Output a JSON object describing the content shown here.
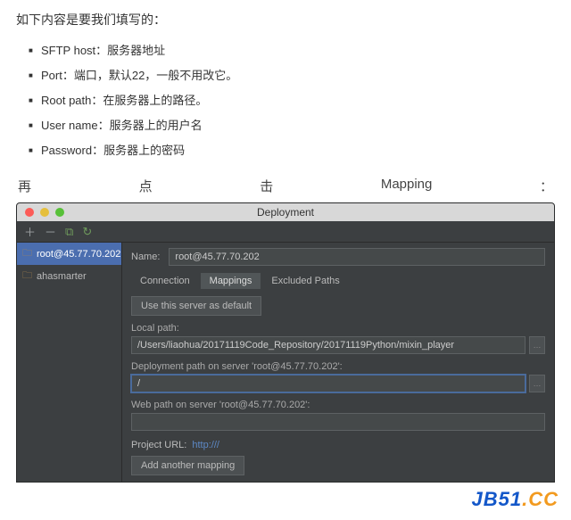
{
  "doc": {
    "lead": "如下内容是要我们填写的：",
    "bullets": [
      "SFTP host：服务器地址",
      "Port：端口，默认22，一般不用改它。",
      "Root path：在服务器上的路径。",
      "User name：服务器上的用户名",
      "Password：服务器上的密码"
    ],
    "spread": [
      "再",
      "点",
      "击",
      "Mapping",
      "："
    ]
  },
  "win": {
    "title": "Deployment",
    "sidebar": {
      "items": [
        {
          "label": "root@45.77.70.202",
          "selected": true
        },
        {
          "label": "ahasmarter",
          "selected": false
        }
      ]
    },
    "main": {
      "name_label": "Name:",
      "name_value": "root@45.77.70.202",
      "tabs": [
        {
          "label": "Connection",
          "active": false
        },
        {
          "label": "Mappings",
          "active": true
        },
        {
          "label": "Excluded Paths",
          "active": false
        }
      ],
      "default_btn": "Use this server as default",
      "local_path_label": "Local path:",
      "local_path_value": "/Users/liaohua/20171119Code_Repository/20171119Python/mixin_player",
      "deploy_path_label": "Deployment path on server 'root@45.77.70.202':",
      "deploy_path_value": "/",
      "web_path_label": "Web path on server 'root@45.77.70.202':",
      "web_path_value": "",
      "project_url_label": "Project URL:",
      "project_url_value": "http:///",
      "add_mapping_btn": "Add another mapping"
    }
  },
  "watermark": {
    "a": "JB51",
    "b": ".CC"
  }
}
